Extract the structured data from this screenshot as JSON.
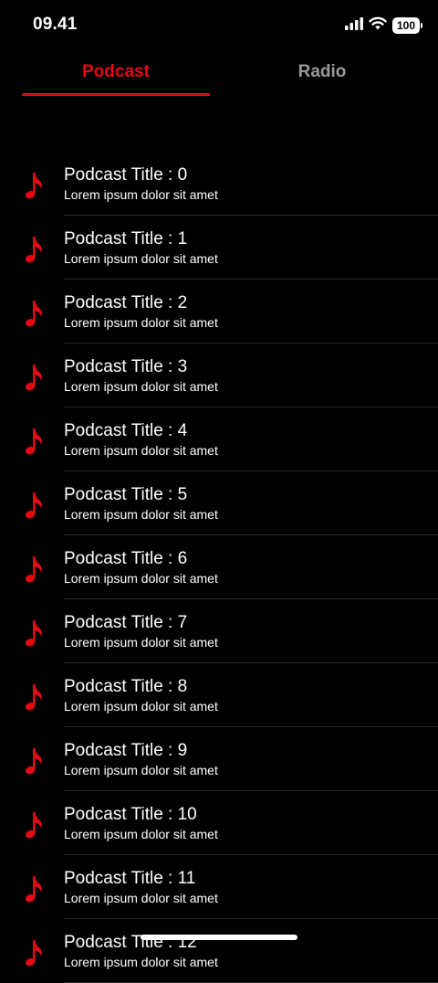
{
  "status_bar": {
    "time": "09.41",
    "battery": "100",
    "icons": [
      "signal-icon",
      "wifi-icon",
      "battery-icon"
    ]
  },
  "tabs": [
    {
      "label": "Podcast",
      "active": true
    },
    {
      "label": "Radio",
      "active": false
    }
  ],
  "colors": {
    "accent": "#e50914",
    "background": "#000000",
    "inactive_tab": "#9a9a9a",
    "divider": "#2a2a2a"
  },
  "list": {
    "item_icon": "music-note-icon",
    "items": [
      {
        "title": "Podcast Title : 0",
        "subtitle": "Lorem ipsum dolor sit amet"
      },
      {
        "title": "Podcast Title : 1",
        "subtitle": "Lorem ipsum dolor sit amet"
      },
      {
        "title": "Podcast Title : 2",
        "subtitle": "Lorem ipsum dolor sit amet"
      },
      {
        "title": "Podcast Title : 3",
        "subtitle": "Lorem ipsum dolor sit amet"
      },
      {
        "title": "Podcast Title : 4",
        "subtitle": "Lorem ipsum dolor sit amet"
      },
      {
        "title": "Podcast Title : 5",
        "subtitle": "Lorem ipsum dolor sit amet"
      },
      {
        "title": "Podcast Title : 6",
        "subtitle": "Lorem ipsum dolor sit amet"
      },
      {
        "title": "Podcast Title : 7",
        "subtitle": "Lorem ipsum dolor sit amet"
      },
      {
        "title": "Podcast Title : 8",
        "subtitle": "Lorem ipsum dolor sit amet"
      },
      {
        "title": "Podcast Title : 9",
        "subtitle": "Lorem ipsum dolor sit amet"
      },
      {
        "title": "Podcast Title : 10",
        "subtitle": "Lorem ipsum dolor sit amet"
      },
      {
        "title": "Podcast Title : 11",
        "subtitle": "Lorem ipsum dolor sit amet"
      },
      {
        "title": "Podcast Title : 12",
        "subtitle": "Lorem ipsum dolor sit amet"
      }
    ]
  }
}
